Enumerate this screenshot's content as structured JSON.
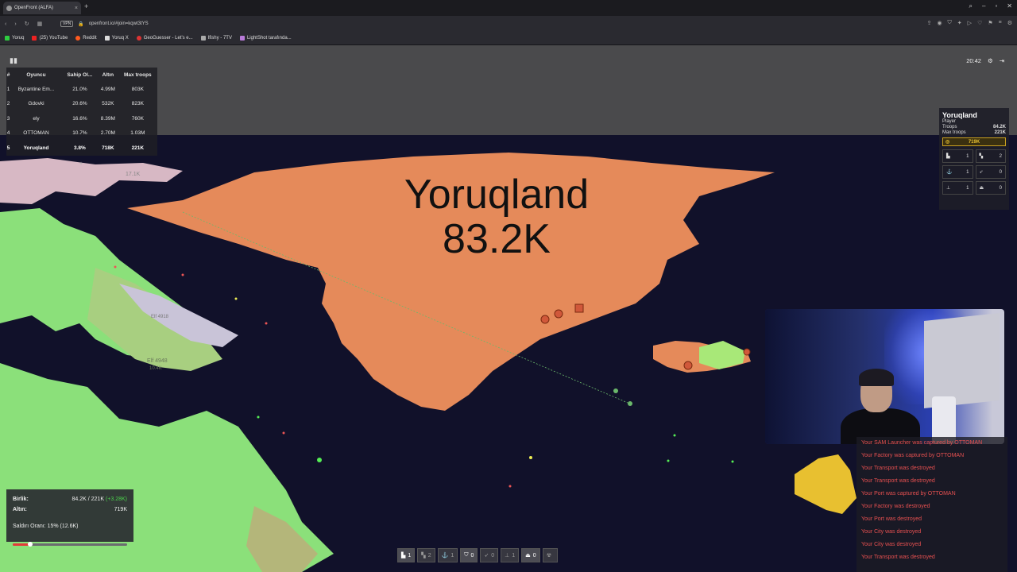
{
  "browser": {
    "tab_title": "OpenFront (ALFA)",
    "url": "openfront.io/#join=kqwt3tYS",
    "vpn": "VPN",
    "bookmarks": [
      "Yoruq",
      "(25) YouTube",
      "Reddit",
      "Yoruq X",
      "GeoGuesser - Let's e...",
      "Ifishy - 7TV",
      "LightShot tarafında..."
    ]
  },
  "leaderboard": {
    "headers": [
      "#",
      "Oyuncu",
      "Sahip Ol...",
      "Altın",
      "Max troops"
    ],
    "rows": [
      {
        "rank": "1",
        "player": "Byzantine Em...",
        "owned": "21.0%",
        "gold": "4.99M",
        "max_troops": "803K"
      },
      {
        "rank": "2",
        "player": "Gdovki",
        "owned": "20.6%",
        "gold": "532K",
        "max_troops": "823K"
      },
      {
        "rank": "3",
        "player": "ely",
        "owned": "16.6%",
        "gold": "8.39M",
        "max_troops": "760K"
      },
      {
        "rank": "4",
        "player": "OTTOMAN",
        "owned": "10.7%",
        "gold": "2.70M",
        "max_troops": "1.03M"
      },
      {
        "rank": "5",
        "player": "Yoruqland",
        "owned": "3.8%",
        "gold": "718K",
        "max_troops": "221K"
      }
    ],
    "more": "+"
  },
  "clock": "20:42",
  "player_info": {
    "name": "Yoruqland",
    "role": "Player",
    "troops_label": "Troops",
    "troops": "84.2K",
    "max_troops_label": "Max troops",
    "max_troops": "221K",
    "gold": "719K",
    "buildings": [
      {
        "icon": "city-icon",
        "count": "1"
      },
      {
        "icon": "factory-icon",
        "count": "2"
      },
      {
        "icon": "port-icon",
        "count": "1"
      },
      {
        "icon": "missile-icon",
        "count": "0"
      },
      {
        "icon": "sam-icon",
        "count": "1"
      },
      {
        "icon": "warship-icon",
        "count": "0"
      }
    ]
  },
  "map": {
    "territory_name": "Yoruqland",
    "territory_troops": "83.2K",
    "small_labels": [
      "17.1K",
      "Elf 4948",
      "10.4K",
      "Elf 4918"
    ]
  },
  "events": [
    "Your SAM Launcher was captured by OTTOMAN",
    "Your Factory was captured by OTTOMAN",
    "Your Transport was destroyed",
    "Your Transport was destroyed",
    "Your Port was captured by OTTOMAN",
    "Your Factory was destroyed",
    "Your Port was destroyed",
    "Your City was destroyed",
    "Your City was destroyed",
    "Your Transport was destroyed"
  ],
  "stats": {
    "troops_label": "Birlik:",
    "troops_value": "84.2K / 221K",
    "troops_gain": "(+3.28K)",
    "gold_label": "Altın:",
    "gold_value": "719K",
    "attack_ratio_label": "Saldırı Oranı: 15% (12.6K)",
    "attack_ratio": 0.15
  },
  "buildbar": [
    {
      "icon": "city-icon",
      "count": "1"
    },
    {
      "icon": "factory-icon",
      "count": "2"
    },
    {
      "icon": "port-icon",
      "count": "1"
    },
    {
      "icon": "defense-icon",
      "count": "0"
    },
    {
      "icon": "sam-icon",
      "count": "0"
    },
    {
      "icon": "missile-icon",
      "count": "1"
    },
    {
      "icon": "warship-icon",
      "count": "0"
    },
    {
      "icon": "nuke-icon",
      "count": ""
    }
  ],
  "colors": {
    "player_territory": "#e58a5a",
    "enemy_green": "#8be07a",
    "ocean": "#11112a",
    "event_text": "#e65050",
    "gold": "#e8c030"
  }
}
